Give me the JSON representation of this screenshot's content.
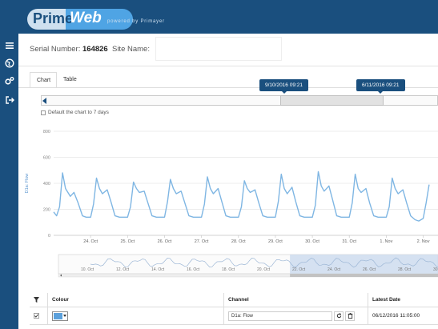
{
  "header": {
    "logo_prime": "Prime",
    "logo_web": "Web",
    "powered": "powered by Primayer"
  },
  "sidebar": {
    "icons": [
      "menu-icon",
      "globe-icon",
      "settings-icon",
      "logout-icon"
    ]
  },
  "site": {
    "serial_label": "Serial Number:",
    "serial_value": "164826",
    "site_label": "Site Name:"
  },
  "tabs": [
    {
      "label": "Chart",
      "active": true
    },
    {
      "label": "Table",
      "active": false
    }
  ],
  "navigator": {
    "start_date": "9/10/2016 09:21",
    "end_date": "6/11/2016 09:21",
    "window_start_fraction": 0.61,
    "window_end_fraction": 0.87
  },
  "default_option": "Default the chart to 7 days",
  "chart_data": {
    "type": "line",
    "ylabel": "D1a: Flow",
    "ylim": [
      0,
      800
    ],
    "yticks": [
      "800",
      "600",
      "400",
      "200",
      "0"
    ],
    "xticks": [
      "24. Oct",
      "25. Oct",
      "26. Oct",
      "27. Oct",
      "28. Oct",
      "29. Oct",
      "30. Oct",
      "31. Oct",
      "1. Nov",
      "2. Nov"
    ],
    "navigator_ticks": [
      "10. Oct",
      "12. Oct",
      "14. Oct",
      "16. Oct",
      "18. Oct",
      "20. Oct",
      "22. Oct",
      "24. Oct",
      "26. Oct",
      "28. Oct",
      "30. Oct",
      "1. Nov",
      "3. Nov",
      "5. Nov"
    ],
    "series": [
      {
        "color": "#7fb6e3",
        "x_days_from_23oct": [
          0.0,
          0.08,
          0.16,
          0.24,
          0.32,
          0.45,
          0.55,
          0.66,
          0.78,
          0.88,
          1.0,
          1.08,
          1.16,
          1.24,
          1.32,
          1.45,
          1.55,
          1.66,
          1.78,
          1.88,
          2.0,
          2.08,
          2.16,
          2.24,
          2.32,
          2.45,
          2.55,
          2.66,
          2.78,
          2.88,
          3.0,
          3.08,
          3.16,
          3.24,
          3.32,
          3.45,
          3.55,
          3.66,
          3.78,
          3.88,
          4.0,
          4.08,
          4.16,
          4.24,
          4.32,
          4.45,
          4.55,
          4.66,
          4.78,
          4.88,
          5.0,
          5.08,
          5.16,
          5.24,
          5.32,
          5.45,
          5.55,
          5.66,
          5.78,
          5.88,
          6.0,
          6.08,
          6.16,
          6.24,
          6.32,
          6.45,
          6.55,
          6.66,
          6.78,
          6.88,
          7.0,
          7.08,
          7.16,
          7.24,
          7.32,
          7.45,
          7.55,
          7.66,
          7.78,
          7.88,
          8.0,
          8.08,
          8.16,
          8.24,
          8.32,
          8.45,
          8.55,
          8.66,
          8.78,
          8.88,
          9.0,
          9.08,
          9.16,
          9.24,
          9.32,
          9.45,
          9.55,
          9.66,
          9.78,
          9.88,
          10.0,
          10.08,
          10.16
        ],
        "values": [
          180,
          150,
          220,
          480,
          360,
          300,
          330,
          250,
          150,
          140,
          140,
          240,
          440,
          360,
          320,
          350,
          260,
          150,
          140,
          140,
          140,
          220,
          410,
          360,
          330,
          340,
          250,
          150,
          140,
          140,
          140,
          260,
          430,
          360,
          320,
          340,
          250,
          150,
          140,
          140,
          140,
          240,
          450,
          360,
          320,
          360,
          260,
          150,
          140,
          140,
          140,
          220,
          420,
          360,
          330,
          350,
          250,
          150,
          140,
          140,
          140,
          260,
          470,
          360,
          320,
          370,
          260,
          150,
          140,
          140,
          140,
          230,
          490,
          380,
          340,
          380,
          270,
          150,
          140,
          140,
          140,
          250,
          470,
          360,
          330,
          360,
          250,
          150,
          140,
          140,
          140,
          220,
          440,
          360,
          320,
          350,
          250,
          150,
          120,
          110,
          130,
          250,
          390
        ]
      }
    ]
  },
  "table": {
    "headers": {
      "filter": "",
      "colour": "Colour",
      "channel": "Channel",
      "latest_date": "Latest Date"
    },
    "rows": [
      {
        "channel": "D1a: Flow",
        "latest_date": "06/12/2016 11:05:00"
      }
    ]
  }
}
